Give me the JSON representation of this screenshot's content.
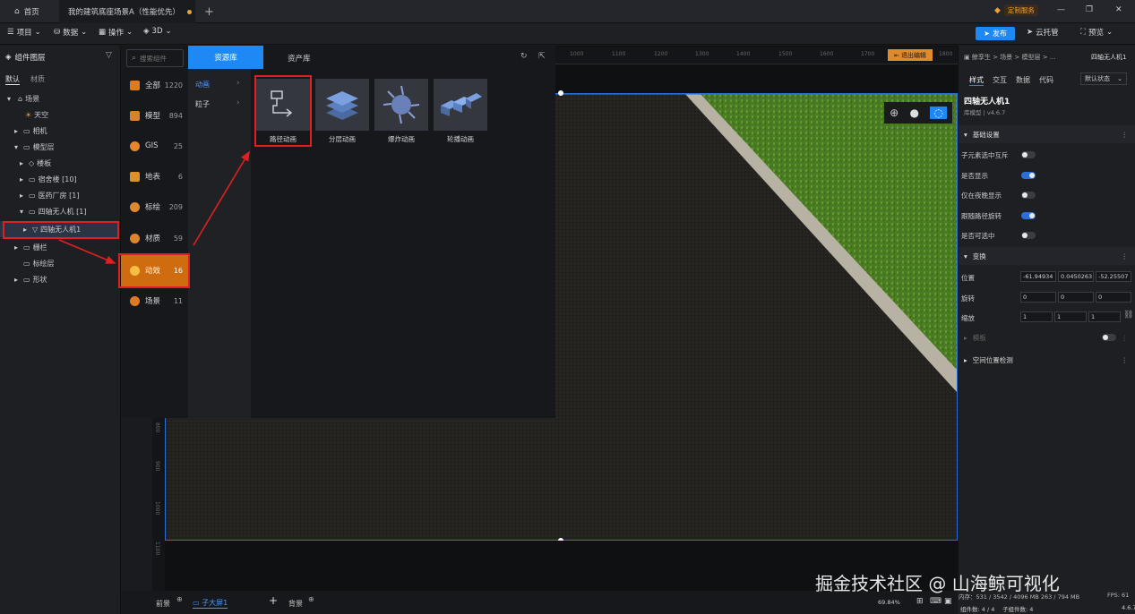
{
  "titlebar": {
    "home_tab": "首页",
    "scene_tab": "我的建筑底座场景A（性能优先）",
    "new_tab": "+",
    "service_badge": "定制服务",
    "window_min": "—",
    "window_max": "❐",
    "window_close": "✕"
  },
  "menubar": {
    "items": [
      "项目",
      "数据",
      "操作",
      "3D"
    ],
    "publish": "发布",
    "cloud_host": "云托管",
    "preview": "预览"
  },
  "left_panel": {
    "title": "组件图层",
    "tabs": [
      "默认",
      "材质"
    ],
    "tree": [
      {
        "label": "场景",
        "depth": 0
      },
      {
        "label": "天空",
        "depth": 1
      },
      {
        "label": "相机",
        "depth": 1
      },
      {
        "label": "模型层",
        "depth": 1
      },
      {
        "label": "楼板",
        "depth": 2
      },
      {
        "label": "宿舍楼 [10]",
        "depth": 2
      },
      {
        "label": "医药厂房 [1]",
        "depth": 2
      },
      {
        "label": "四轴无人机 [1]",
        "depth": 2
      },
      {
        "label": "四轴无人机1",
        "depth": 3
      },
      {
        "label": "栅栏",
        "depth": 1
      },
      {
        "label": "标绘层",
        "depth": 1
      },
      {
        "label": "形状",
        "depth": 1
      }
    ]
  },
  "resource_panel": {
    "search_placeholder": "搜索组件",
    "tab_resource": "资源库",
    "tab_asset": "资产库",
    "categories": [
      {
        "label": "全部",
        "count": "1220",
        "color": "#e07a20"
      },
      {
        "label": "模型",
        "count": "894",
        "color": "#d9822b"
      },
      {
        "label": "GIS",
        "count": "25",
        "color": "#e8862e"
      },
      {
        "label": "地表",
        "count": "6",
        "color": "#e0902b"
      },
      {
        "label": "标绘",
        "count": "209",
        "color": "#e08a30"
      },
      {
        "label": "材质",
        "count": "59",
        "color": "#e0842b"
      },
      {
        "label": "动效",
        "count": "16",
        "color": "#f5c040"
      },
      {
        "label": "场景",
        "count": "11",
        "color": "#e07a20"
      }
    ],
    "sub_categories": [
      "动画",
      "粒子"
    ],
    "items": [
      "路径动画",
      "分层动画",
      "爆炸动画",
      "轮播动画"
    ]
  },
  "ruler": {
    "top_ticks": [
      "1000",
      "1100",
      "1200",
      "1300",
      "1400",
      "1500",
      "1600",
      "1700",
      "1800"
    ],
    "left_ticks": [
      "800",
      "900",
      "1000",
      "1100"
    ],
    "exit_edit": "退出编辑"
  },
  "right_panel": {
    "breadcrumb": "鲸孪生 > 场景 > 模型层 > ...",
    "breadcrumb_tail": "四轴无人机1",
    "tabs": [
      "样式",
      "交互",
      "数据",
      "代码"
    ],
    "state_select": "默认状态",
    "component_name": "四轴无人机1",
    "component_sub": "库模型 | v4.6.7",
    "section_basic": "基础设置",
    "basic_rows": [
      {
        "label": "子元素选中互斥",
        "on": false
      },
      {
        "label": "是否显示",
        "on": true
      },
      {
        "label": "仅在夜晚显示",
        "on": false
      },
      {
        "label": "跟随路径旋转",
        "on": true
      },
      {
        "label": "是否可选中",
        "on": false
      }
    ],
    "section_transform": "变换",
    "position_label": "位置",
    "position": [
      "-61.94934",
      "0.0450263",
      "-52.25507"
    ],
    "rotation_label": "旋转",
    "rotation": [
      "0",
      "0",
      "0"
    ],
    "scale_label": "缩放",
    "scale": [
      "1",
      "1",
      "1"
    ],
    "section_template": "模板",
    "section_space": "空间位置检测"
  },
  "bottom": {
    "foreground": "前景",
    "child_scene": "子大屏1",
    "background": "背景",
    "zoom": "69.84%",
    "memory": "内存：531 / 3542 / 4096 MB  263 / 794 MB",
    "fps": "FPS: 61",
    "component_count": "组件数: 4 / 4",
    "child_count": "子组件数: 4",
    "version": "4.6.7"
  },
  "watermark": "掘金技术社区 @ 山海鲸可视化",
  "colors": {
    "accent": "#1e88f5",
    "highlight": "#e02020",
    "active_cat": "#d06c10"
  }
}
